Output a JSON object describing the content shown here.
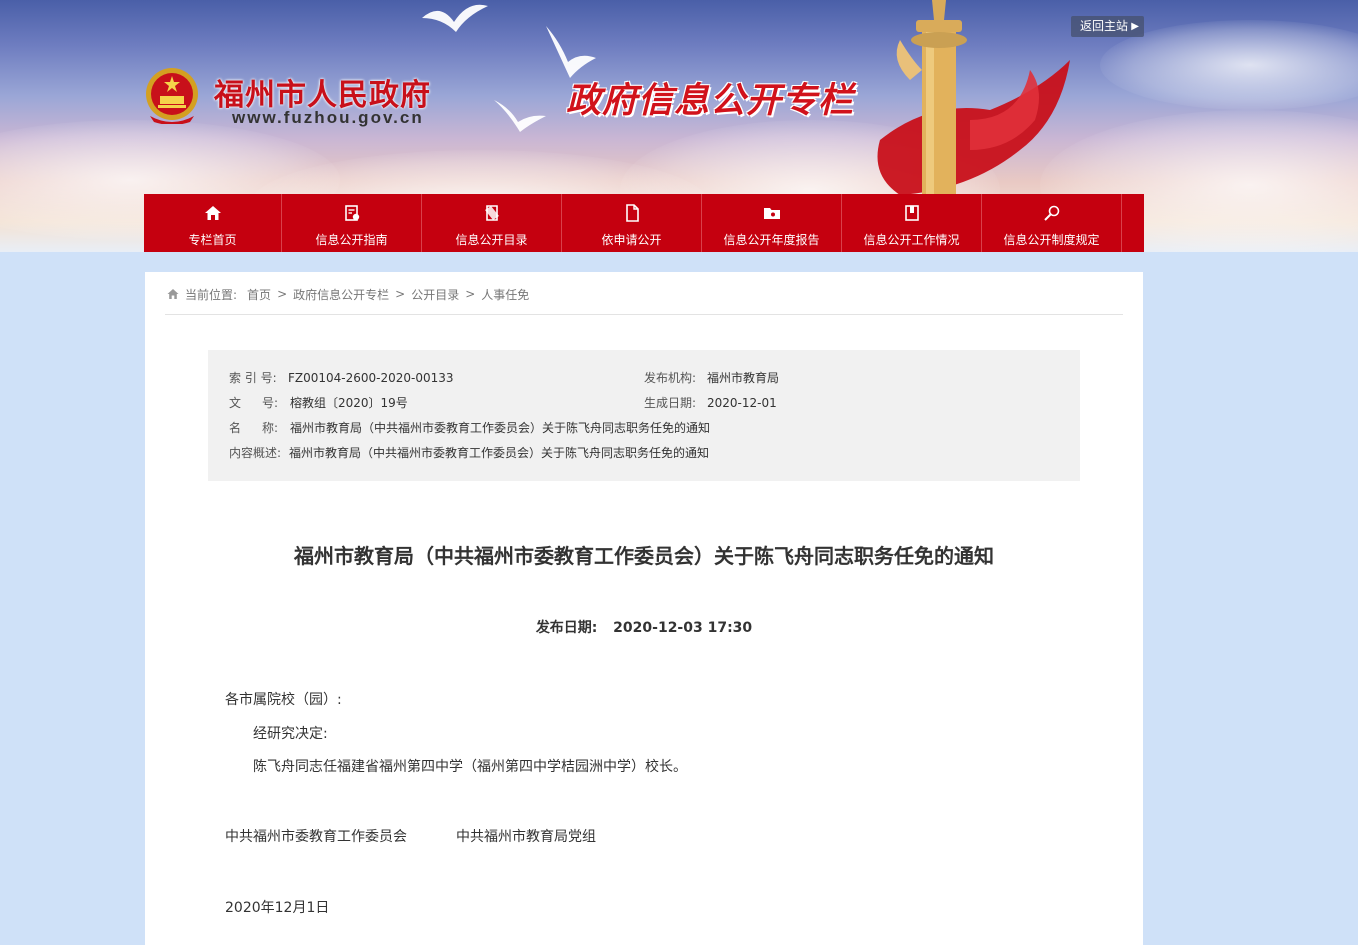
{
  "header": {
    "site_title": "福州市人民政府",
    "site_url": "www.fuzhou.gov.cn",
    "column_title": "政府信息公开专栏",
    "return_label": "返回主站"
  },
  "nav": {
    "items": [
      {
        "label": "专栏首页",
        "icon": "home-icon"
      },
      {
        "label": "信息公开指南",
        "icon": "guide-icon"
      },
      {
        "label": "信息公开目录",
        "icon": "catalog-icon"
      },
      {
        "label": "依申请公开",
        "icon": "document-icon"
      },
      {
        "label": "信息公开年度报告",
        "icon": "report-icon"
      },
      {
        "label": "信息公开工作情况",
        "icon": "work-icon"
      },
      {
        "label": "信息公开制度规定",
        "icon": "rules-icon"
      }
    ]
  },
  "breadcrumb": {
    "prefix": "当前位置:",
    "items": [
      "首页",
      "政府信息公开专栏",
      "公开目录",
      "人事任免"
    ],
    "separator": ">"
  },
  "meta": {
    "index_label": "索 引 号:",
    "index_value": "FZ00104-2600-2020-00133",
    "publisher_label": "发布机构:",
    "publisher_value": "福州市教育局",
    "docno_label_1": "文",
    "docno_label_2": "号:",
    "docno_value": "榕教组〔2020〕19号",
    "gen_date_label": "生成日期:",
    "gen_date_value": "2020-12-01",
    "name_label_1": "名",
    "name_label_2": "称:",
    "name_value": "福州市教育局（中共福州市委教育工作委员会）关于陈飞舟同志职务任免的通知",
    "summary_label": "内容概述:",
    "summary_value": "福州市教育局（中共福州市委教育工作委员会）关于陈飞舟同志职务任免的通知"
  },
  "article": {
    "title": "福州市教育局（中共福州市委教育工作委员会）关于陈飞舟同志职务任免的通知",
    "date_label": "发布日期:",
    "date_value": "2020-12-03 17:30",
    "salutation": "各市属院校（园）:",
    "para1": "经研究决定:",
    "para2": "陈飞舟同志任福建省福州第四中学（福州第四中学桔园洲中学）校长。",
    "signer1": "中共福州市委教育工作委员会",
    "signer2": "中共福州市教育局党组",
    "sign_date": "2020年12月1日"
  },
  "colors": {
    "nav_red": "#c5000f",
    "title_red": "#c8101a",
    "page_bg": "#cfe1f8",
    "meta_bg": "#f1f1f1"
  }
}
